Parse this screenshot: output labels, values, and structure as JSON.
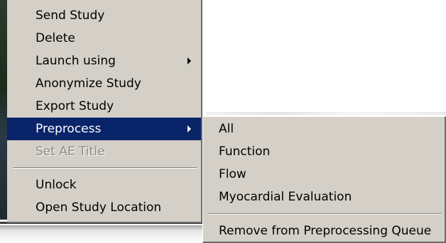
{
  "main_menu": {
    "items": [
      {
        "label": "Send Study"
      },
      {
        "label": "Delete"
      },
      {
        "label": "Launch using"
      },
      {
        "label": "Anonymize Study"
      },
      {
        "label": "Export Study"
      },
      {
        "label": "Preprocess"
      },
      {
        "label": "Set AE Title"
      },
      {
        "label": "Unlock"
      },
      {
        "label": "Open Study Location"
      }
    ]
  },
  "submenu": {
    "items": [
      {
        "label": "All"
      },
      {
        "label": "Function"
      },
      {
        "label": "Flow"
      },
      {
        "label": "Myocardial Evaluation"
      },
      {
        "label": "Remove from Preprocessing Queue"
      }
    ]
  },
  "colors": {
    "menu_bg": "#d4d0c8",
    "highlight_bg": "#0a246a",
    "highlight_text": "#ffffff",
    "disabled_text": "#8a8a8a"
  },
  "icons": [
    "submenu-arrow-icon"
  ]
}
